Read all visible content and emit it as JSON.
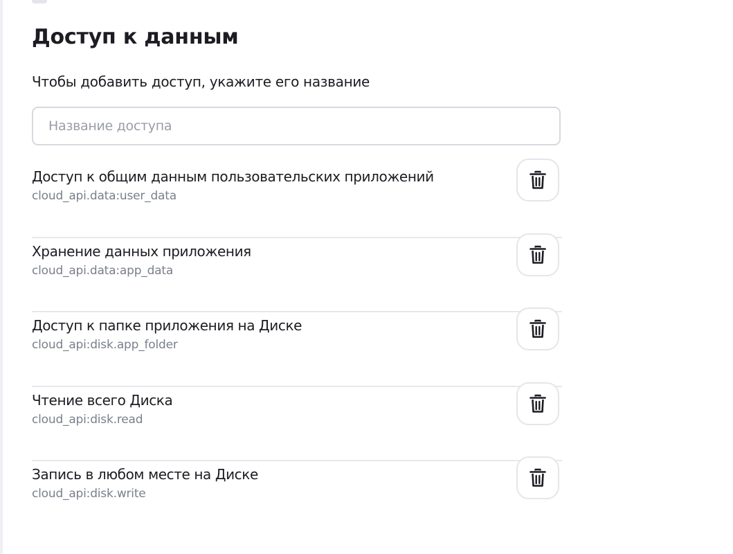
{
  "section": {
    "title": "Доступ к данным",
    "hint": "Чтобы добавить доступ, укажите его название"
  },
  "search": {
    "placeholder": "Название доступа",
    "value": ""
  },
  "scopes": [
    {
      "title": "Доступ к общим данным пользовательских приложений",
      "id": "cloud_api.data:user_data",
      "action_icon": "trash-icon"
    },
    {
      "title": "Хранение данных приложения",
      "id": "cloud_api.data:app_data",
      "action_icon": "trash-icon"
    },
    {
      "title": "Доступ к папке приложения на Диске",
      "id": "cloud_api:disk.app_folder",
      "action_icon": "trash-icon"
    },
    {
      "title": "Чтение всего Диска",
      "id": "cloud_api:disk.read",
      "action_icon": "trash-icon"
    },
    {
      "title": "Запись в любом месте на Диске",
      "id": "cloud_api:disk.write",
      "action_icon": "trash-icon"
    }
  ],
  "colors": {
    "text": "#1c1c22",
    "secondary_text": "#7a7f8b",
    "placeholder": "#9a9da7",
    "border": "#d6d9df",
    "divider": "#e6e8ec"
  }
}
